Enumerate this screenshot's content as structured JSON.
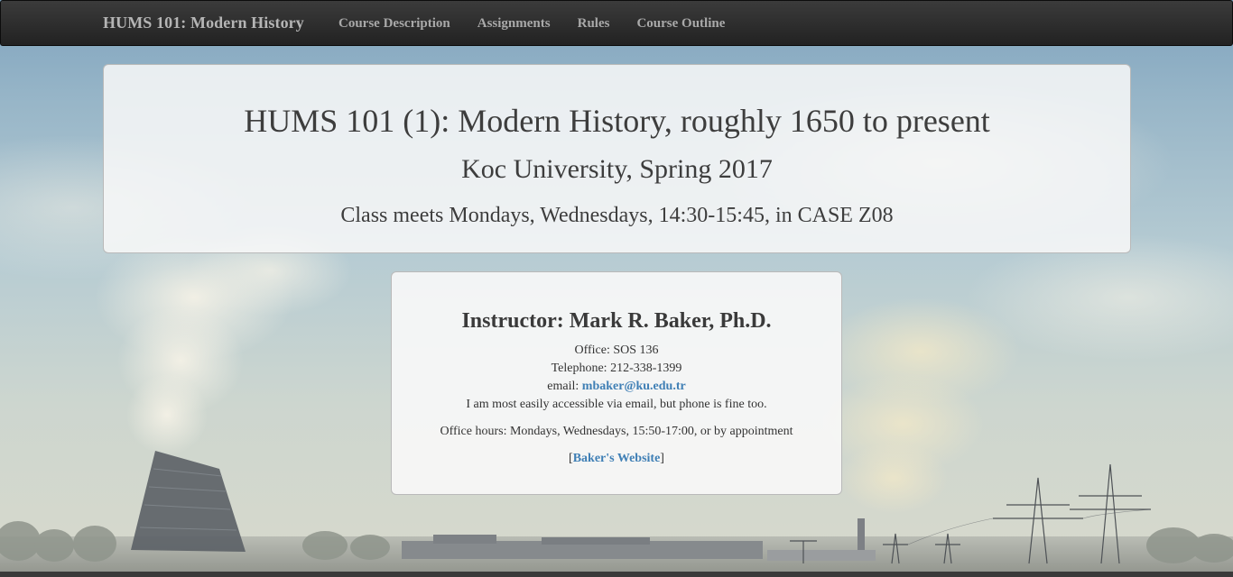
{
  "navbar": {
    "brand": "HUMS 101: Modern History",
    "links": [
      {
        "label": "Course Description"
      },
      {
        "label": "Assignments"
      },
      {
        "label": "Rules"
      },
      {
        "label": "Course Outline"
      }
    ]
  },
  "header": {
    "title": "HUMS 101 (1): Modern History, roughly 1650 to present",
    "subtitle": "Koc University, Spring 2017",
    "schedule": "Class meets Mondays, Wednesdays, 14:30-15:45, in CASE Z08"
  },
  "instructor": {
    "heading": "Instructor: Mark R. Baker, Ph.D.",
    "office": "Office: SOS 136",
    "telephone": "Telephone: 212-338-1399",
    "email_label": "email:",
    "email": "mbaker@ku.edu.tr",
    "contact_note": "I am most easily accessible via email, but phone is fine too.",
    "office_hours": "Office hours: Mondays, Wednesdays, 15:50-17:00, or by appointment",
    "website_open_bracket": "[",
    "website_link": "Baker's Website",
    "website_close_bracket": "]"
  },
  "colors": {
    "navbar_bg": "#2b2b2b",
    "nav_text": "#a9a9a9",
    "link": "#3f7fb5",
    "panel_bg": "#f8f8f8"
  }
}
